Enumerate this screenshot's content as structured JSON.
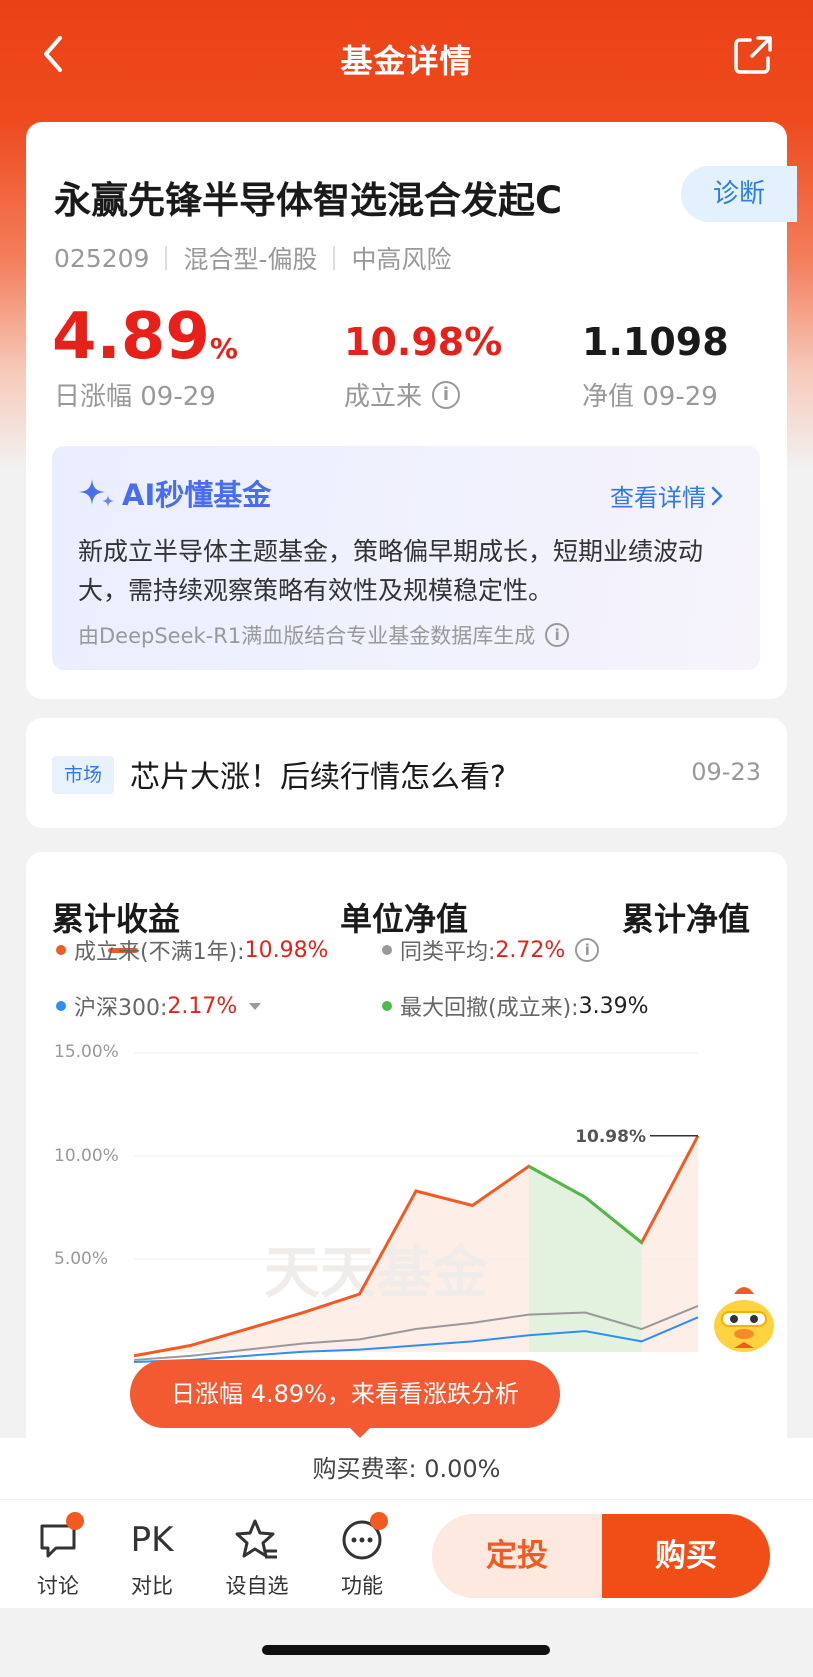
{
  "header": {
    "title": "基金详情"
  },
  "fund": {
    "name": "永赢先锋半导体智选混合发起C",
    "diagnose_label": "诊断",
    "code": "025209",
    "category": "混合型-偏股",
    "risk": "中高风险",
    "daily_change": "4.89",
    "daily_change_unit": "%",
    "daily_change_label": "日涨幅 09-29",
    "since_inception": "10.98%",
    "since_inception_label": "成立来",
    "nav": "1.1098",
    "nav_label": "净值 09-29"
  },
  "ai": {
    "title": "AI秒懂基金",
    "more": "查看详情",
    "text": "新成立半导体主题基金，策略偏早期成长，短期业绩波动大，需持续观察策略有效性及规模稳定性。",
    "footer": "由DeepSeek-R1满血版结合专业基金数据库生成"
  },
  "news": {
    "tag": "市场",
    "title": "芯片大涨！后续行情怎么看?",
    "date": "09-23"
  },
  "chart": {
    "tabs": [
      "累计收益",
      "单位净值",
      "累计净值"
    ],
    "legend": {
      "since_label": "成立来(不满1年): ",
      "since_val": "10.98%",
      "peer_label": "同类平均: ",
      "peer_val": "2.72%",
      "hs300_label": "沪深300: ",
      "hs300_val": "2.17%",
      "dd_label": "最大回撤(成立来): ",
      "dd_val": "3.39%"
    },
    "y_labels": [
      "15.00%",
      "10.00%",
      "5.00%"
    ],
    "end_label": "10.98%",
    "watermark": "天天基金",
    "bubble": "日涨幅 4.89%，来看看涨跌分析"
  },
  "chart_data": {
    "type": "line",
    "ylim": [
      0,
      15
    ],
    "y_ticks": [
      15,
      10,
      5
    ],
    "series": [
      {
        "name": "成立来",
        "color": "#f15a22",
        "values": [
          0.3,
          0.8,
          1.6,
          2.4,
          3.3,
          8.3,
          7.6,
          9.5,
          8.0,
          5.8,
          10.98
        ]
      },
      {
        "name": "同类平均",
        "color": "#999999",
        "values": [
          0.1,
          0.3,
          0.6,
          0.9,
          1.1,
          1.6,
          1.9,
          2.3,
          2.4,
          1.6,
          2.72
        ]
      },
      {
        "name": "沪深300",
        "color": "#2f8ef0",
        "values": [
          0.0,
          0.1,
          0.3,
          0.5,
          0.6,
          0.8,
          1.0,
          1.3,
          1.5,
          1.0,
          2.17
        ]
      }
    ],
    "drawdown_segment": [
      7,
      9
    ]
  },
  "footer": {
    "fee_text": "购买费率: 0.00%",
    "items": [
      "讨论",
      "对比",
      "设自选",
      "功能"
    ],
    "pk_label": "PK",
    "regular_invest": "定投",
    "buy": "购买"
  },
  "colors": {
    "brand": "#ea4216",
    "up": "#e8201a",
    "accent_blue": "#2f78e6"
  }
}
